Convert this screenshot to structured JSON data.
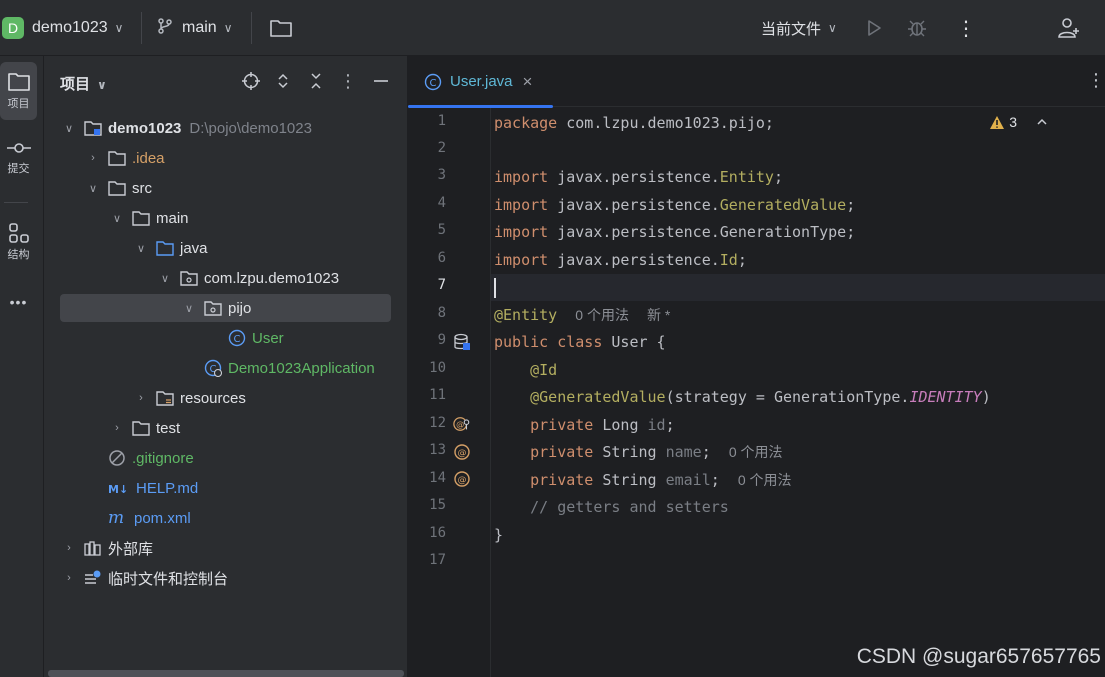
{
  "topbar": {
    "project_badge": "D",
    "project_name": "demo1023",
    "branch": "main",
    "run_config": "当前文件"
  },
  "leftstrip": {
    "project": "项目",
    "commit": "提交",
    "structure": "结构",
    "more": "•••"
  },
  "panel": {
    "title": "项目",
    "tree": [
      {
        "label": "demo1023",
        "hint": "D:\\pojo\\demo1023"
      },
      {
        "label": ".idea"
      },
      {
        "label": "src"
      },
      {
        "label": "main"
      },
      {
        "label": "java"
      },
      {
        "label": "com.lzpu.demo1023"
      },
      {
        "label": "pijo"
      },
      {
        "label": "User"
      },
      {
        "label": "Demo1023Application"
      },
      {
        "label": "resources"
      },
      {
        "label": "test"
      },
      {
        "label": ".gitignore"
      },
      {
        "label": "HELP.md"
      },
      {
        "label": "pom.xml"
      },
      {
        "label": "外部库"
      },
      {
        "label": "临时文件和控制台"
      }
    ]
  },
  "editor": {
    "tab": {
      "label": "User.java",
      "icon": "C",
      "close": "×"
    },
    "warnings": "3",
    "line_numbers": [
      "1",
      "2",
      "3",
      "4",
      "5",
      "6",
      "7",
      "8",
      "9",
      "10",
      "11",
      "12",
      "13",
      "14",
      "15",
      "16",
      "17"
    ],
    "lines": {
      "l1_kw": "package",
      "l1_rest": " com.lzpu.demo1023.pijo;",
      "l3_kw": "import",
      "l3_pkg": " javax.persistence.",
      "l3_cls": "Entity",
      "l3_end": ";",
      "l4_kw": "import",
      "l4_pkg": " javax.persistence.",
      "l4_cls": "GeneratedValue",
      "l4_end": ";",
      "l5_kw": "import",
      "l5_rest": " javax.persistence.GenerationType;",
      "l6_kw": "import",
      "l6_pkg": " javax.persistence.",
      "l6_cls": "Id",
      "l6_end": ";",
      "l8_ann": "@Entity",
      "l8_hint1": "0 个用法",
      "l8_hint2": "新 *",
      "l9_kw": "public class",
      "l9_rest": " User {",
      "l10_ann": "@Id",
      "l11_ann": "@GeneratedValue",
      "l11_rest": "(strategy = GenerationType.",
      "l11_fld": "IDENTITY",
      "l11_end": ")",
      "l12_kw": "private",
      "l12_type": " Long ",
      "l12_var": "id",
      "l12_end": ";",
      "l13_kw": "private",
      "l13_type": " String ",
      "l13_var": "name",
      "l13_end": ";",
      "l13_hint": "0 个用法",
      "l14_kw": "private",
      "l14_type": " String ",
      "l14_var": "email",
      "l14_end": ";",
      "l14_hint": "0 个用法",
      "l15_cmt": "// getters and setters",
      "l16": "}"
    }
  },
  "watermark": "CSDN @sugar657657765"
}
